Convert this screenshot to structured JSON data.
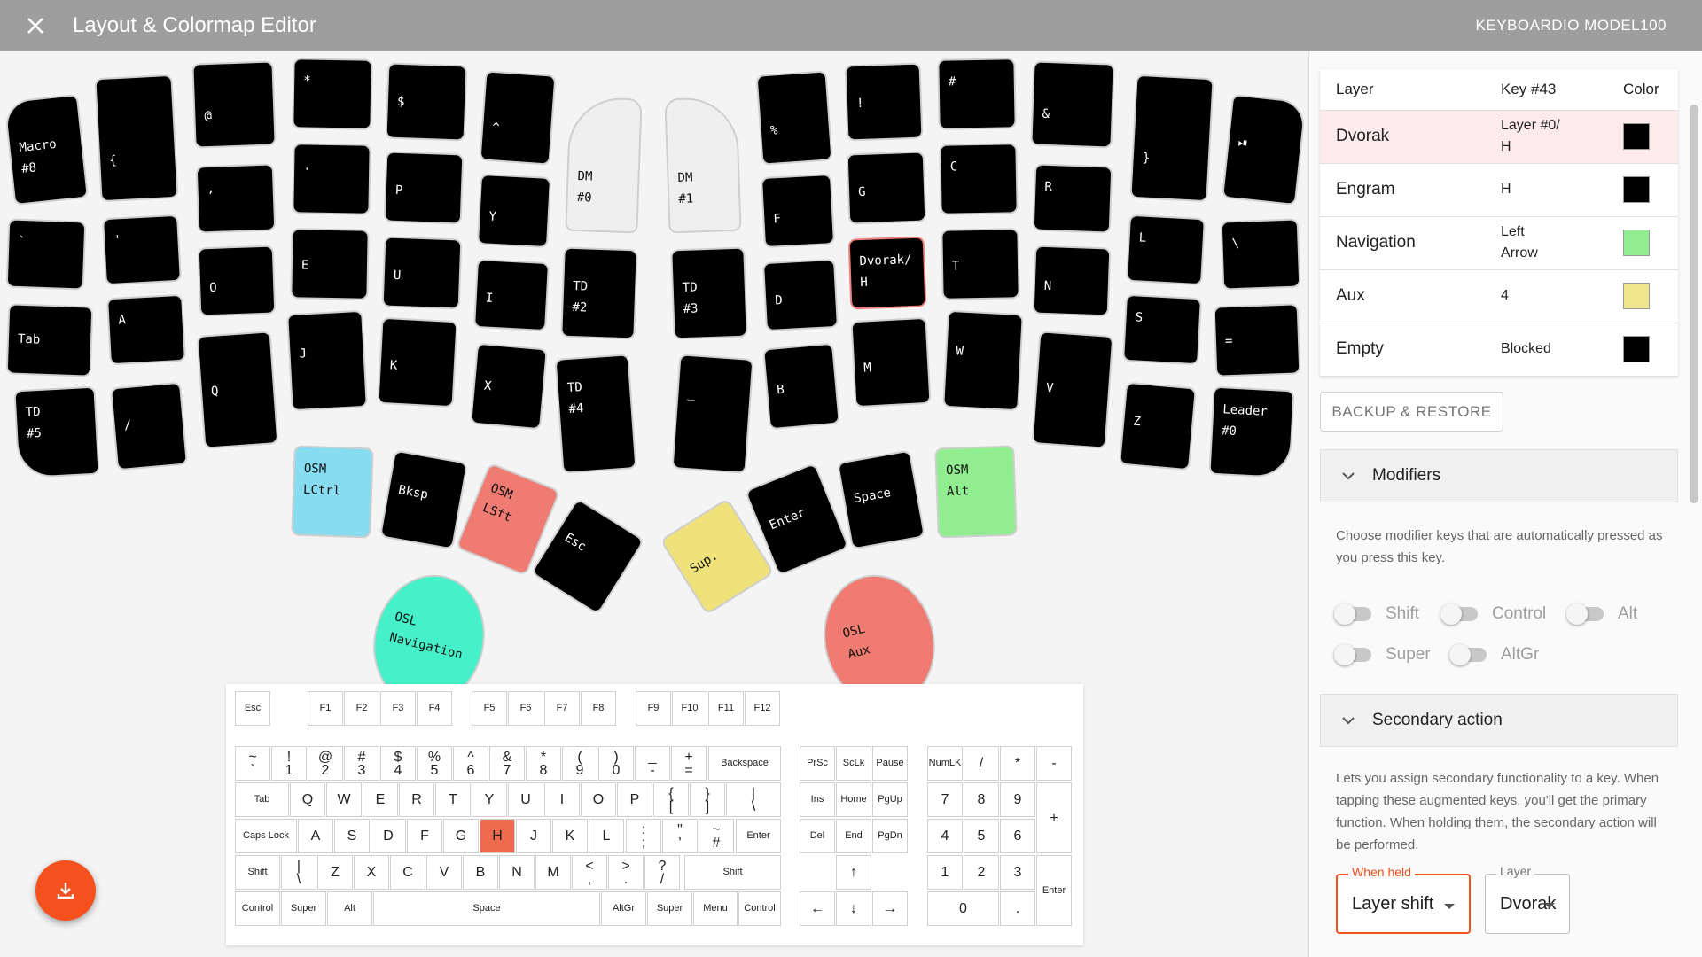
{
  "appbar": {
    "title": "Layout & Colormap Editor",
    "device": "KEYBOARDIO MODEL100"
  },
  "layout_keys": {
    "lm1": "Macro\n#8",
    "lm2": "`",
    "lm3": "Tab",
    "lm4": "TD\n#5",
    "l11": "{",
    "l12": "'",
    "l13": "A",
    "l14": "/",
    "l21": "@",
    "l22": ",",
    "l23": "O",
    "l24": "Q",
    "l31": "*",
    "l32": ".",
    "l33": "E",
    "l34": "J",
    "l41": "$",
    "l42": "P",
    "l43": "U",
    "l44": "K",
    "l51": "^",
    "l52": "Y",
    "l53": "I",
    "l54": "X",
    "l61": "DM\n#0",
    "l62": "TD\n#2",
    "l63": "TD\n#4",
    "r61": "DM\n#1",
    "r62": "TD\n#3",
    "r63": "_",
    "r51": "%",
    "r52": "F",
    "r53": "D",
    "r54": "B",
    "r41": "!",
    "r42": "G",
    "r43": "Dvorak/\nH",
    "r44": "M",
    "r31": "#",
    "r32": "C",
    "r33": "T",
    "r34": "W",
    "r21": "&",
    "r22": "R",
    "r23": "N",
    "r24": "V",
    "r11": "}",
    "r12": "L",
    "r13": "S",
    "r14": "Z",
    "rm1": "⏯",
    "rm2": "\\",
    "rm3": "=",
    "rm4": "Leader\n#0",
    "lt1": "OSM\nLCtrl",
    "lt2": "Bksp",
    "lt3": "OSM\nLSft",
    "lt4": "Esc",
    "rt1": "Sup.",
    "rt2": "Enter",
    "rt3": "Space",
    "rt4": "OSM\nAlt",
    "lp": "OSL\nNavigation",
    "rp": "OSL\nAux"
  },
  "keyboard": {
    "fn": [
      "Esc",
      "F1",
      "F2",
      "F3",
      "F4",
      "F5",
      "F6",
      "F7",
      "F8",
      "F9",
      "F10",
      "F11",
      "F12"
    ],
    "num_row": [
      [
        "~",
        "`"
      ],
      [
        "!",
        "1"
      ],
      [
        "@",
        "2"
      ],
      [
        "#",
        "3"
      ],
      [
        "$",
        "4"
      ],
      [
        "%",
        "5"
      ],
      [
        "^",
        "6"
      ],
      [
        "&",
        "7"
      ],
      [
        "*",
        "8"
      ],
      [
        "(",
        "9"
      ],
      [
        ")",
        "0"
      ],
      [
        "_",
        "-"
      ],
      [
        "+",
        "="
      ]
    ],
    "backspace": "Backspace",
    "tab": "Tab",
    "qrow": [
      "Q",
      "W",
      "E",
      "R",
      "T",
      "Y",
      "U",
      "I",
      "O",
      "P"
    ],
    "qrow_extra": [
      [
        "{",
        "["
      ],
      [
        "}",
        "]"
      ],
      [
        "|",
        "\\"
      ]
    ],
    "caps": "Caps Lock",
    "arow": [
      "A",
      "S",
      "D",
      "F",
      "G",
      "H",
      "J",
      "K",
      "L"
    ],
    "arow_extra": [
      [
        ":",
        ";"
      ],
      [
        "\"",
        "'"
      ],
      [
        "~",
        "#"
      ]
    ],
    "enter": "Enter",
    "shift_l": "Shift",
    "zrow_pipe": [
      "|",
      "\\"
    ],
    "zrow": [
      "Z",
      "X",
      "C",
      "V",
      "B",
      "N",
      "M"
    ],
    "zrow_extra": [
      [
        "<",
        ","
      ],
      [
        ">",
        "."
      ],
      [
        "?",
        "/"
      ]
    ],
    "shift_r": "Shift",
    "bottom": [
      "Control",
      "Super",
      "Alt",
      "Space",
      "AltGr",
      "Super",
      "Menu",
      "Control"
    ],
    "nav1": [
      "PrSc",
      "ScLk",
      "Pause"
    ],
    "nav2": [
      "Ins",
      "Home",
      "PgUp"
    ],
    "nav3": [
      "Del",
      "End",
      "PgDn"
    ],
    "arrows": [
      "↑",
      "←",
      "↓",
      "→"
    ],
    "numpad": {
      "r1": [
        "NumLK",
        "/",
        "*",
        "-"
      ],
      "r2": [
        "7",
        "8",
        "9"
      ],
      "plus": "+",
      "r3": [
        "4",
        "5",
        "6"
      ],
      "r4": [
        "1",
        "2",
        "3"
      ],
      "zero": "0",
      "dot": ".",
      "enter": "Enter"
    },
    "selected": "H"
  },
  "layer_table": {
    "headers": {
      "layer": "Layer",
      "key": "Key #43",
      "color": "Color"
    },
    "rows": [
      {
        "layer": "Dvorak",
        "key": "Layer #0/\nH",
        "color": "#000000"
      },
      {
        "layer": "Engram",
        "key": "H",
        "color": "#000000"
      },
      {
        "layer": "Navigation",
        "key": "Left\nArrow",
        "color": "#90ee90"
      },
      {
        "layer": "Aux",
        "key": "4",
        "color": "#f0e68c"
      },
      {
        "layer": "Empty",
        "key": "Blocked",
        "color": "#000000"
      }
    ]
  },
  "backup_label": "BACKUP & RESTORE",
  "modifiers": {
    "title": "Modifiers",
    "desc": "Choose modifier keys that are automatically pressed as you press this key.",
    "toggles": [
      "Shift",
      "Control",
      "Alt",
      "Super",
      "AltGr"
    ]
  },
  "secondary": {
    "title": "Secondary action",
    "desc": "Lets you assign secondary functionality to a key. When tapping these augmented keys, you'll get the primary function. When holding them, the secondary action will be performed.",
    "when_held_label": "When held",
    "when_held_value": "Layer shift",
    "layer_label": "Layer",
    "layer_value": "Dvorak"
  },
  "colors": {
    "accent": "#f4511e",
    "osm_ctrl": "#87dcf0",
    "osm_shift": "#ef7b72",
    "osm_alt": "#90ee90",
    "sup": "#f0e27a",
    "osl_nav": "#46f0c8",
    "osl_aux": "#ef7b72",
    "selected_key": "#ef6a4f"
  }
}
